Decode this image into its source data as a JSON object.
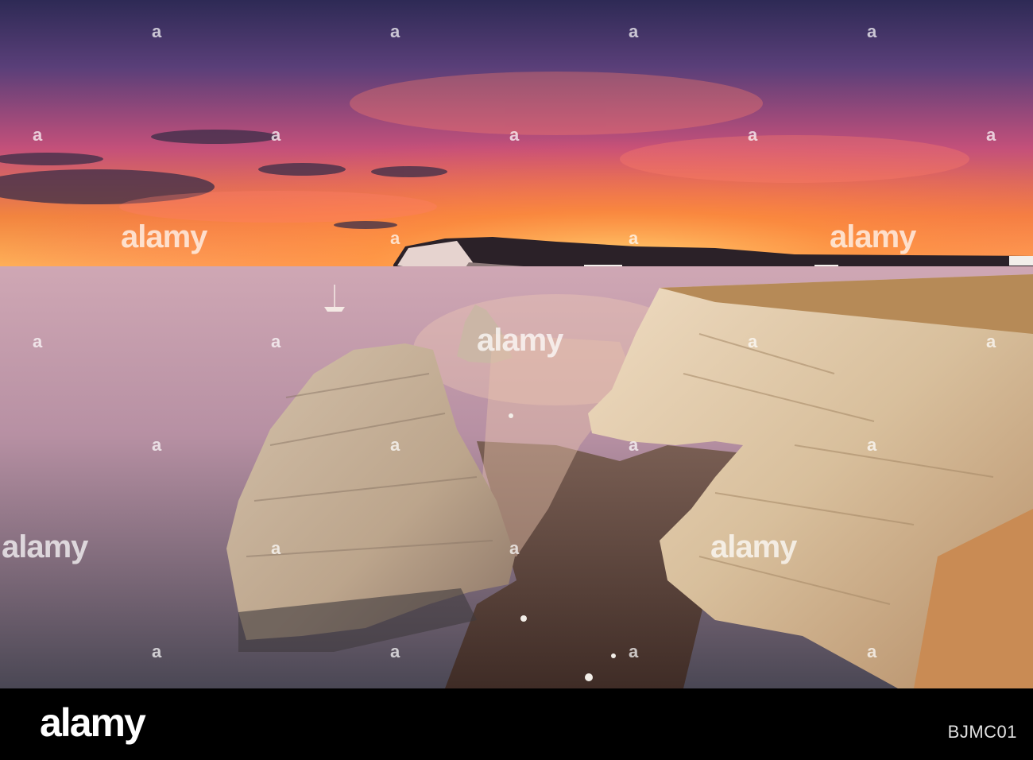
{
  "watermark": {
    "brand": "alamy",
    "mark": "a"
  },
  "footer": {
    "logo": "alamy",
    "image_ref": "BJMC01"
  },
  "scene": {
    "description_icon": "sunset-coast-photo",
    "colors": {
      "sky_top": "#3b2f5c",
      "sky_glow": "#ff9a3c",
      "sea": "#a98e9b",
      "cliff": "#d9c4a4"
    }
  }
}
